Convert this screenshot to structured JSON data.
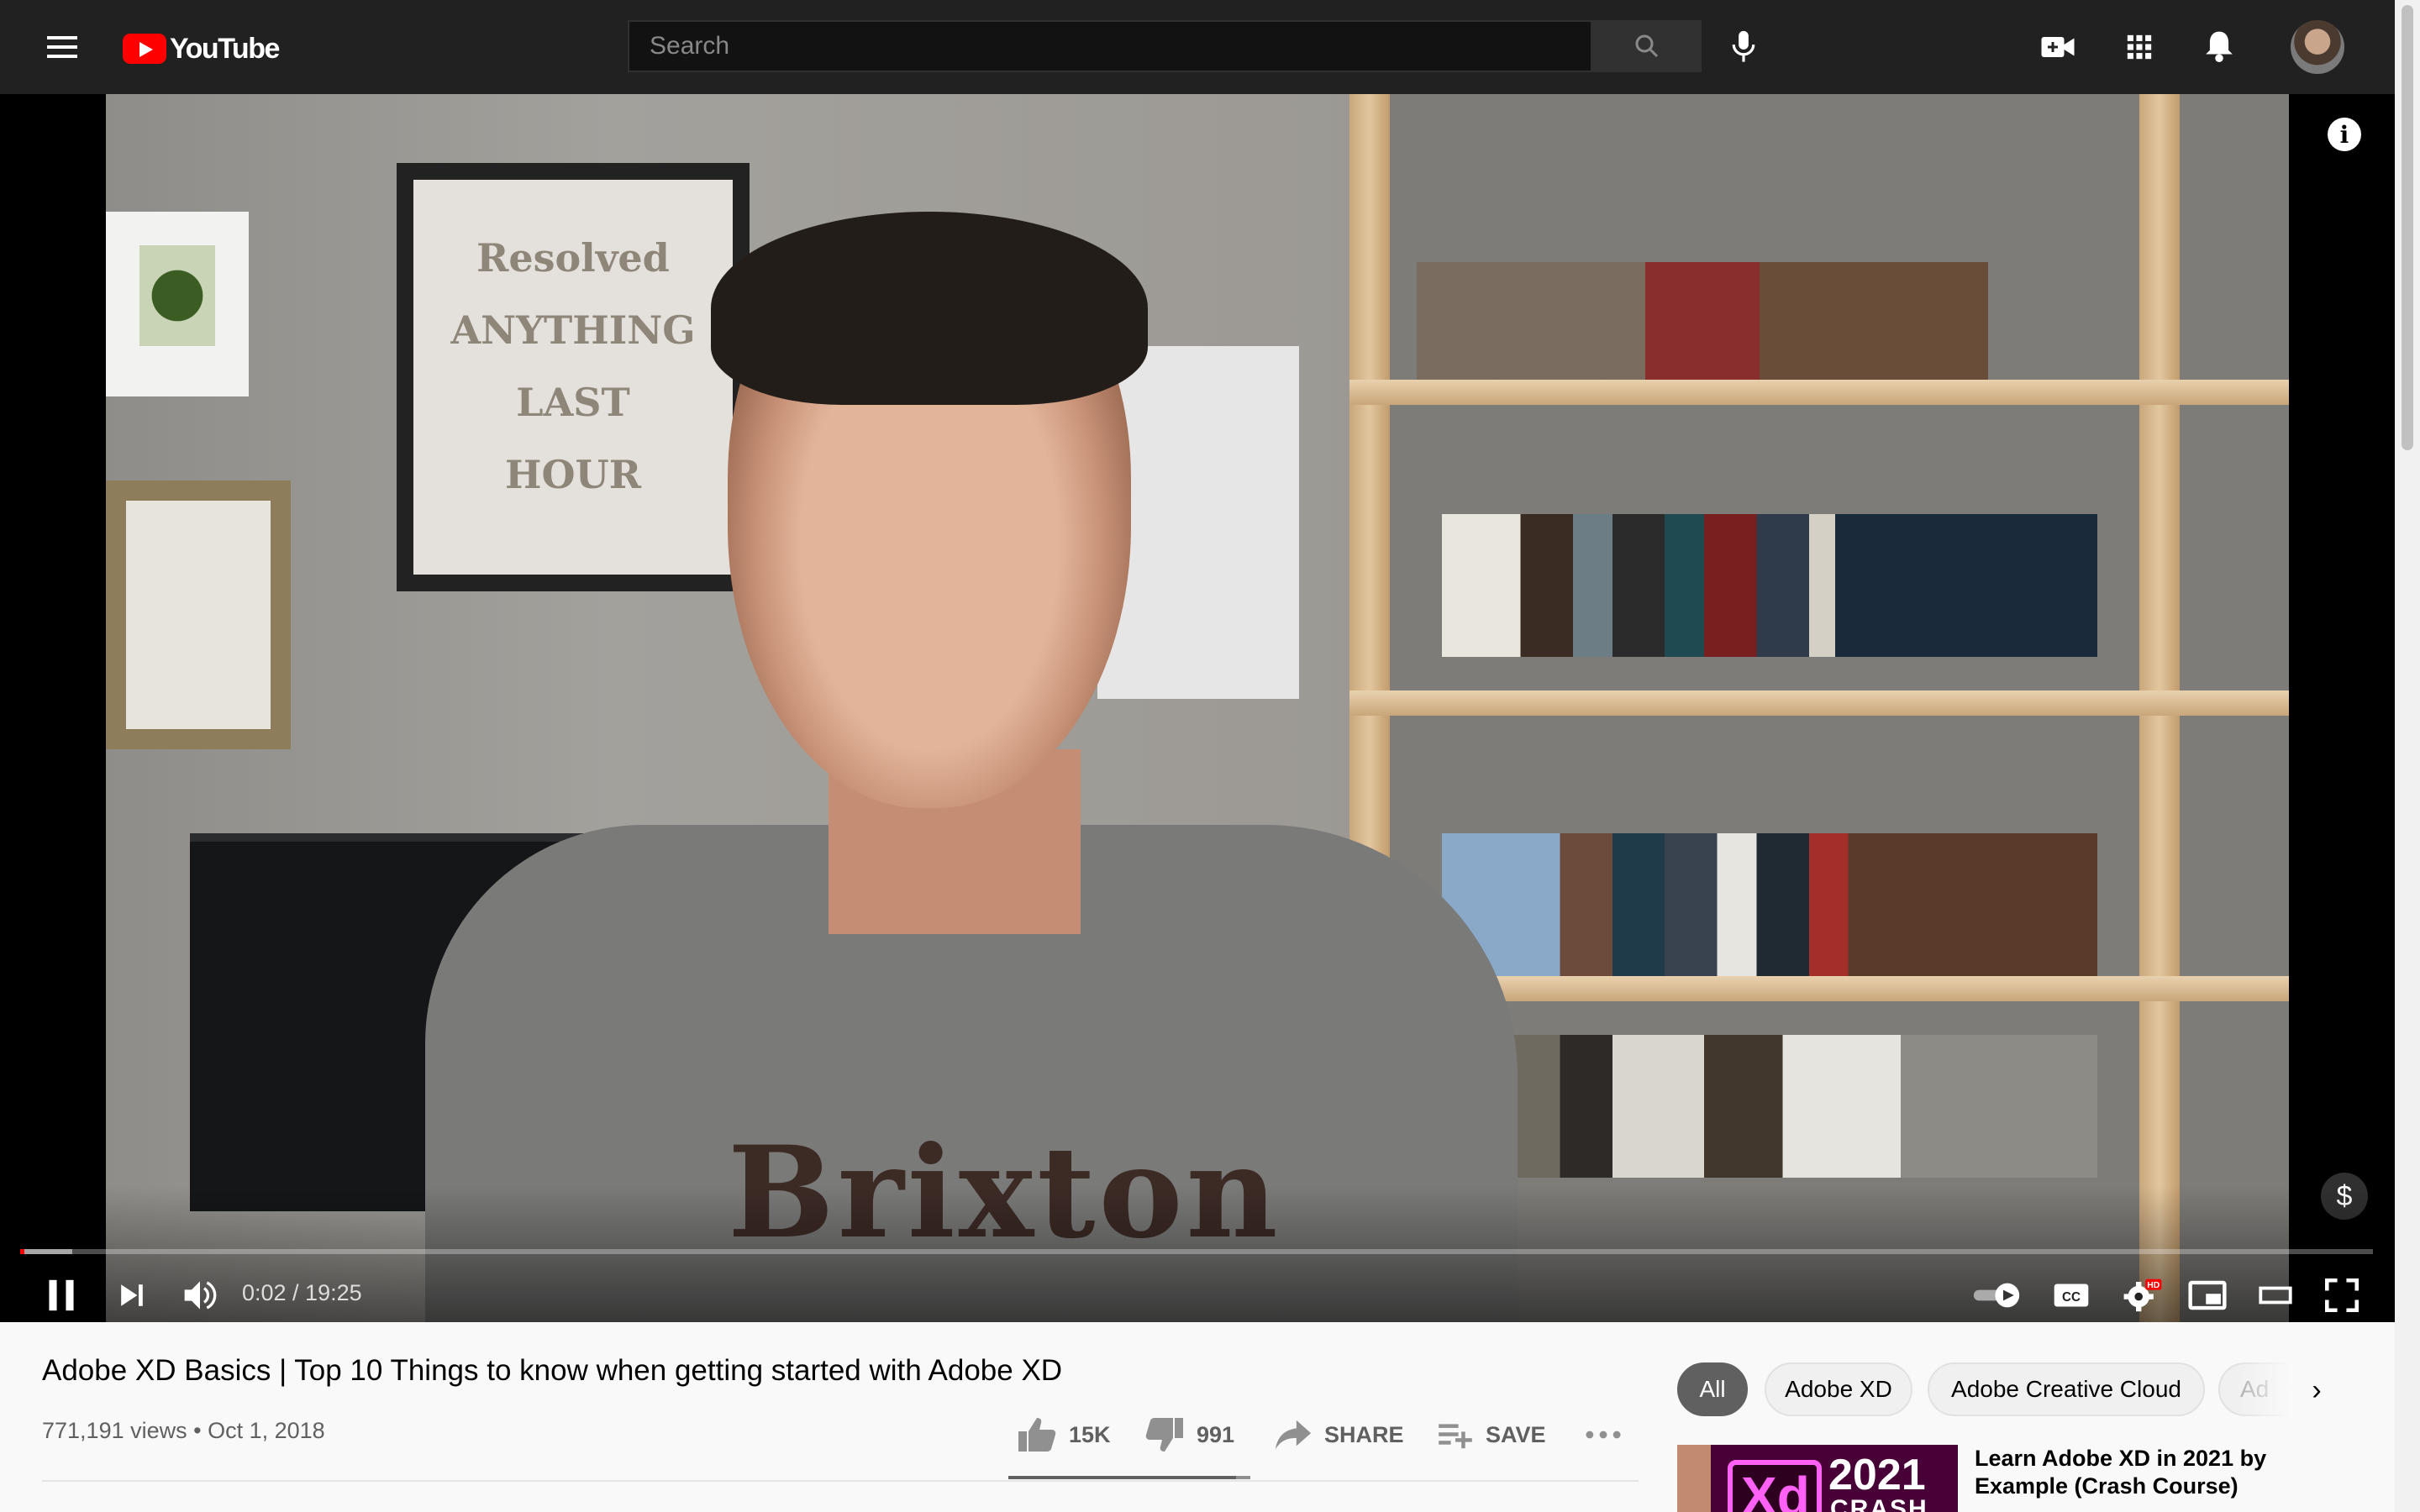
{
  "header": {
    "logo_text": "YouTube",
    "search_placeholder": "Search"
  },
  "player": {
    "current_time": "0:02",
    "duration": "19:25",
    "time_display": "0:02 / 19:25",
    "progress_fraction": 0.0017,
    "buffered_fraction": 0.022,
    "shirt_text": "Brixton",
    "poster_text": "Resolved ANYTHING LAST HOUR",
    "settings_badge": "HD",
    "progress_color": "#ff0000"
  },
  "video": {
    "title": "Adobe XD Basics | Top 10 Things to know when getting started with Adobe XD",
    "views": "771,191 views",
    "date": "Oct 1, 2018",
    "meta": "771,191 views • Oct 1, 2018",
    "likes": "15K",
    "dislikes": "991",
    "share_label": "SHARE",
    "save_label": "SAVE",
    "like_ratio": 0.94
  },
  "chips": [
    {
      "label": "All",
      "active": true
    },
    {
      "label": "Adobe XD",
      "active": false
    },
    {
      "label": "Adobe Creative Cloud",
      "active": false
    },
    {
      "label": "Ad",
      "active": false
    }
  ],
  "recommendation": {
    "title": "Learn Adobe XD in 2021 by Example (Crash Course)",
    "thumb_year": "2021",
    "thumb_crash": "CRASH",
    "thumb_logo": "Xd"
  },
  "colors": {
    "topbar": "#212121",
    "brand_red": "#ff0000",
    "chip_active": "#606060",
    "page_bg": "#f9f9f9"
  }
}
